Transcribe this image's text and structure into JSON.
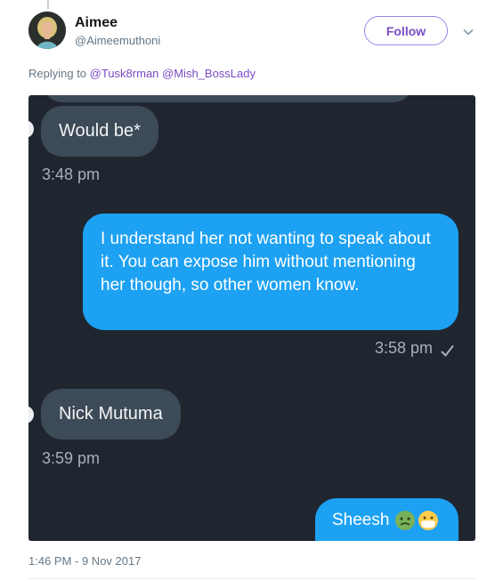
{
  "user": {
    "display_name": "Aimee",
    "handle": "@Aimeemuthoni"
  },
  "follow_label": "Follow",
  "replying": {
    "prefix": "Replying to",
    "mentions": [
      "@Tusk8rman",
      "@Mish_BossLady"
    ]
  },
  "conversation": {
    "messages": [
      {
        "from": "them",
        "text": "Would be*",
        "time": "3:48 pm"
      },
      {
        "from": "me",
        "text": "I understand her not wanting to speak about it. You can expose him without mentioning her though, so other women know.",
        "time": "3:58 pm",
        "status": "delivered"
      },
      {
        "from": "them",
        "text": "Nick Mutuma",
        "time": "3:59 pm"
      },
      {
        "from": "me",
        "text": "Sheesh",
        "emoji": [
          "nauseated-face",
          "face-with-medical-mask"
        ]
      }
    ]
  },
  "tweet_timestamp": "1:46 PM - 9 Nov 2017",
  "colors": {
    "accent": "#794bc4",
    "sent_bubble": "#1da1f2",
    "received_bubble": "#3d4a57",
    "chat_background": "#1f2630"
  }
}
